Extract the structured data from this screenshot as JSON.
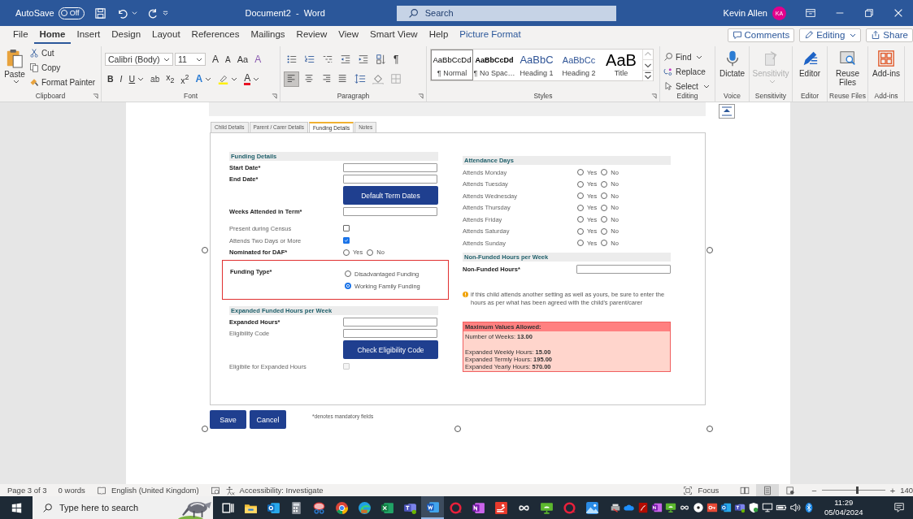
{
  "window": {
    "autosave_label": "AutoSave",
    "autosave": {
      "on": false,
      "label": "Off"
    },
    "title": "Document2  -  Word",
    "search_placeholder": "Search",
    "user_name": "Kevin Allen",
    "user_initials": "KA"
  },
  "ribbon_tabs": [
    {
      "label": "File",
      "selected": false,
      "kind": "standard"
    },
    {
      "label": "Home",
      "selected": true,
      "kind": "standard"
    },
    {
      "label": "Insert",
      "selected": false,
      "kind": "standard"
    },
    {
      "label": "Design",
      "selected": false,
      "kind": "standard"
    },
    {
      "label": "Layout",
      "selected": false,
      "kind": "standard"
    },
    {
      "label": "References",
      "selected": false,
      "kind": "standard"
    },
    {
      "label": "Mailings",
      "selected": false,
      "kind": "standard"
    },
    {
      "label": "Review",
      "selected": false,
      "kind": "standard"
    },
    {
      "label": "View",
      "selected": false,
      "kind": "standard"
    },
    {
      "label": "Smart View",
      "selected": false,
      "kind": "standard"
    },
    {
      "label": "Help",
      "selected": false,
      "kind": "standard"
    },
    {
      "label": "Picture Format",
      "selected": false,
      "kind": "contextual"
    }
  ],
  "ribbon_actions": [
    {
      "label": "Comments",
      "kind": "comments"
    },
    {
      "label": "Editing",
      "kind": "editing"
    },
    {
      "label": "Share",
      "kind": "share"
    }
  ],
  "clipboard": {
    "paste": "Paste",
    "cut": "Cut",
    "copy": "Copy",
    "format_painter": "Format Painter",
    "group": "Clipboard"
  },
  "font": {
    "family": "Calibri (Body)",
    "size": "11",
    "tools": [
      {
        "glyph": "A",
        "kind": "grow"
      },
      {
        "glyph": "A",
        "kind": "shrink"
      },
      {
        "glyph": "Aa",
        "kind": "case"
      },
      {
        "glyph": "A",
        "kind": "clear"
      }
    ],
    "formats": [
      {
        "glyph": "B",
        "kind": "bold"
      },
      {
        "glyph": "I",
        "kind": "italic"
      },
      {
        "glyph": "U",
        "kind": "underline"
      },
      {
        "glyph": "ab",
        "kind": "strike"
      },
      {
        "glyph": "x$_{2}$",
        "kind": "sub"
      },
      {
        "glyph": "x$^{2}$",
        "kind": "sup"
      },
      {
        "glyph": "A",
        "kind": "effects"
      },
      {
        "kind": "highlight"
      },
      {
        "glyph": "A",
        "kind": "color"
      }
    ],
    "group": "Font"
  },
  "paragraph": {
    "pilcrow": "¶",
    "alignment": [
      {
        "kind": "left",
        "selected": true
      },
      {
        "kind": "center",
        "selected": false
      },
      {
        "kind": "right",
        "selected": false
      },
      {
        "kind": "justify",
        "selected": false
      }
    ],
    "group": "Paragraph"
  },
  "styles": {
    "items": [
      {
        "sample": "AaBbCcDd",
        "name": "¶ Normal",
        "kind": "normal",
        "selected": true
      },
      {
        "sample": "AaBbCcDd",
        "name": "¶ No Spac…",
        "kind": "nospacing",
        "selected": false
      },
      {
        "sample": "AaBbC",
        "name": "Heading 1",
        "kind": "heading1",
        "selected": false
      },
      {
        "sample": "AaBbCc",
        "name": "Heading 2",
        "kind": "heading2",
        "selected": false
      },
      {
        "sample": "AaB",
        "name": "Title",
        "kind": "title",
        "selected": false
      }
    ],
    "group": "Styles"
  },
  "editing": {
    "find": "Find",
    "replace": "Replace",
    "select": "Select",
    "group": "Editing"
  },
  "big_groups": [
    {
      "kind": "dictate",
      "label": "Dictate",
      "group": "Voice",
      "disabled": false
    },
    {
      "kind": "sensitivity",
      "label": "Sensitivity",
      "group": "Sensitivity",
      "disabled": true
    },
    {
      "kind": "editor",
      "label": "Editor",
      "group": "Editor",
      "disabled": false
    },
    {
      "kind": "reuse",
      "label": "Reuse Files",
      "group": "Reuse Files",
      "disabled": false
    },
    {
      "kind": "addins",
      "label": "Add-ins",
      "group": "Add-ins",
      "disabled": false
    }
  ],
  "form": {
    "tabs": [
      {
        "label": "Child Details",
        "selected": false
      },
      {
        "label": "Parent / Carer Details",
        "selected": false
      },
      {
        "label": "Funding Details",
        "selected": true
      },
      {
        "label": "Notes",
        "selected": false
      }
    ],
    "funding_details": {
      "heading": "Funding Details",
      "rows": [
        {
          "kind": "text",
          "label": "Start Date*",
          "bold": true
        },
        {
          "kind": "text",
          "label": "End Date*",
          "bold": true
        },
        {
          "kind": "button",
          "label": "Default Term Dates"
        },
        {
          "kind": "text",
          "label": "Weeks Attended in Term*",
          "bold": true
        },
        {
          "kind": "checkbox",
          "label": "Present during Census",
          "bold": false,
          "checked": false,
          "disabled": false
        },
        {
          "kind": "checkbox",
          "label": "Attends Two Days or More",
          "bold": false,
          "checked": true,
          "disabled": false
        },
        {
          "kind": "radio",
          "label": "Nominated for DAF*",
          "bold": true,
          "options": [
            {
              "label": "Yes",
              "selected": false
            },
            {
              "label": "No",
              "selected": false
            }
          ]
        }
      ]
    },
    "funding_type": {
      "label": "Funding Type*",
      "options": [
        {
          "label": "Disadvantaged Funding",
          "selected": false
        },
        {
          "label": "Working Family Funding",
          "selected": true
        }
      ]
    },
    "expanded": {
      "heading": "Expanded Funded Hours per Week",
      "rows": [
        {
          "kind": "text",
          "label": "Expanded Hours*",
          "bold": true
        },
        {
          "kind": "text",
          "label": "Eligibility Code",
          "bold": false
        },
        {
          "kind": "button",
          "label": "Check Eligibility Code"
        },
        {
          "kind": "checkbox",
          "label": "Eligibile for Expanded Hours",
          "bold": false,
          "checked": false,
          "disabled": true
        }
      ]
    },
    "attendance": {
      "heading": "Attendance Days",
      "days": [
        {
          "label": "Attends Monday",
          "options": [
            {
              "label": "Yes",
              "selected": false
            },
            {
              "label": "No",
              "selected": false
            }
          ]
        },
        {
          "label": "Attends Tuesday",
          "options": [
            {
              "label": "Yes",
              "selected": false
            },
            {
              "label": "No",
              "selected": false
            }
          ]
        },
        {
          "label": "Attends Wednesday",
          "options": [
            {
              "label": "Yes",
              "selected": false
            },
            {
              "label": "No",
              "selected": false
            }
          ]
        },
        {
          "label": "Attends Thursday",
          "options": [
            {
              "label": "Yes",
              "selected": false
            },
            {
              "label": "No",
              "selected": false
            }
          ]
        },
        {
          "label": "Attends Friday",
          "options": [
            {
              "label": "Yes",
              "selected": false
            },
            {
              "label": "No",
              "selected": false
            }
          ]
        },
        {
          "label": "Attends Saturday",
          "options": [
            {
              "label": "Yes",
              "selected": false
            },
            {
              "label": "No",
              "selected": false
            }
          ]
        },
        {
          "label": "Attends Sunday",
          "options": [
            {
              "label": "Yes",
              "selected": false
            },
            {
              "label": "No",
              "selected": false
            }
          ]
        }
      ]
    },
    "non_funded": {
      "heading": "Non-Funded Hours per Week",
      "label": "Non-Funded Hours*"
    },
    "note": "if this child attends another setting as well as yours, be sure to enter the hours as per what has been agreed with the child's parent/carer",
    "maximums": {
      "title": "Maximum Values Allowed:",
      "groups": [
        [
          "Number of Weeks: **13.00**"
        ],
        [
          "Expanded Weekly Hours: **15.00**",
          "Expanded Termly Hours: **195.00**",
          "Expanded Yearly Hours: **570.00**"
        ]
      ]
    },
    "buttons": [
      "Save",
      "Cancel"
    ],
    "mandatory_note": "*denotes mandatory fields"
  },
  "status_bar": {
    "page": "Page 3 of 3",
    "words": "0 words",
    "language": "English (United Kingdom)",
    "accessibility": "Accessibility: Investigate",
    "focus": "Focus",
    "views": [
      {
        "kind": "read",
        "selected": false
      },
      {
        "kind": "print",
        "selected": true
      },
      {
        "kind": "web",
        "selected": false
      }
    ],
    "zoom": {
      "minus": "−",
      "plus": "+",
      "level": 0.55,
      "label": "140"
    }
  },
  "taskbar": {
    "search_placeholder": "Type here to search",
    "apps": [
      {
        "kind": "taskview",
        "selected": false
      },
      {
        "kind": "folder",
        "selected": false
      },
      {
        "kind": "mail",
        "selected": false
      },
      {
        "kind": "calculator",
        "selected": false
      },
      {
        "kind": "snip",
        "selected": false
      },
      {
        "kind": "chrome",
        "selected": false
      },
      {
        "kind": "edge",
        "selected": false
      },
      {
        "kind": "excel",
        "selected": false
      },
      {
        "kind": "teams",
        "selected": false
      },
      {
        "kind": "word",
        "selected": true
      },
      {
        "kind": "ring",
        "selected": false
      },
      {
        "kind": "notebook",
        "selected": false
      },
      {
        "kind": "hand",
        "selected": false
      },
      {
        "kind": "infinity",
        "selected": false
      },
      {
        "kind": "monitor",
        "selected": false
      },
      {
        "kind": "ring",
        "selected": false
      },
      {
        "kind": "photos",
        "selected": false
      }
    ],
    "tray": [
      {
        "kind": "printer"
      },
      {
        "kind": "cloud"
      },
      {
        "kind": "pdf"
      },
      {
        "kind": "notebook"
      },
      {
        "kind": "monitor"
      },
      {
        "kind": "infinity"
      },
      {
        "kind": "disc"
      },
      {
        "kind": "key"
      },
      {
        "kind": "mail"
      },
      {
        "kind": "teams"
      },
      {
        "kind": "shield"
      },
      {
        "kind": "pc"
      },
      {
        "kind": "battery"
      },
      {
        "kind": "speaker"
      },
      {
        "kind": "bluetooth"
      }
    ],
    "time": "11:29",
    "date": "05/04/2024"
  }
}
